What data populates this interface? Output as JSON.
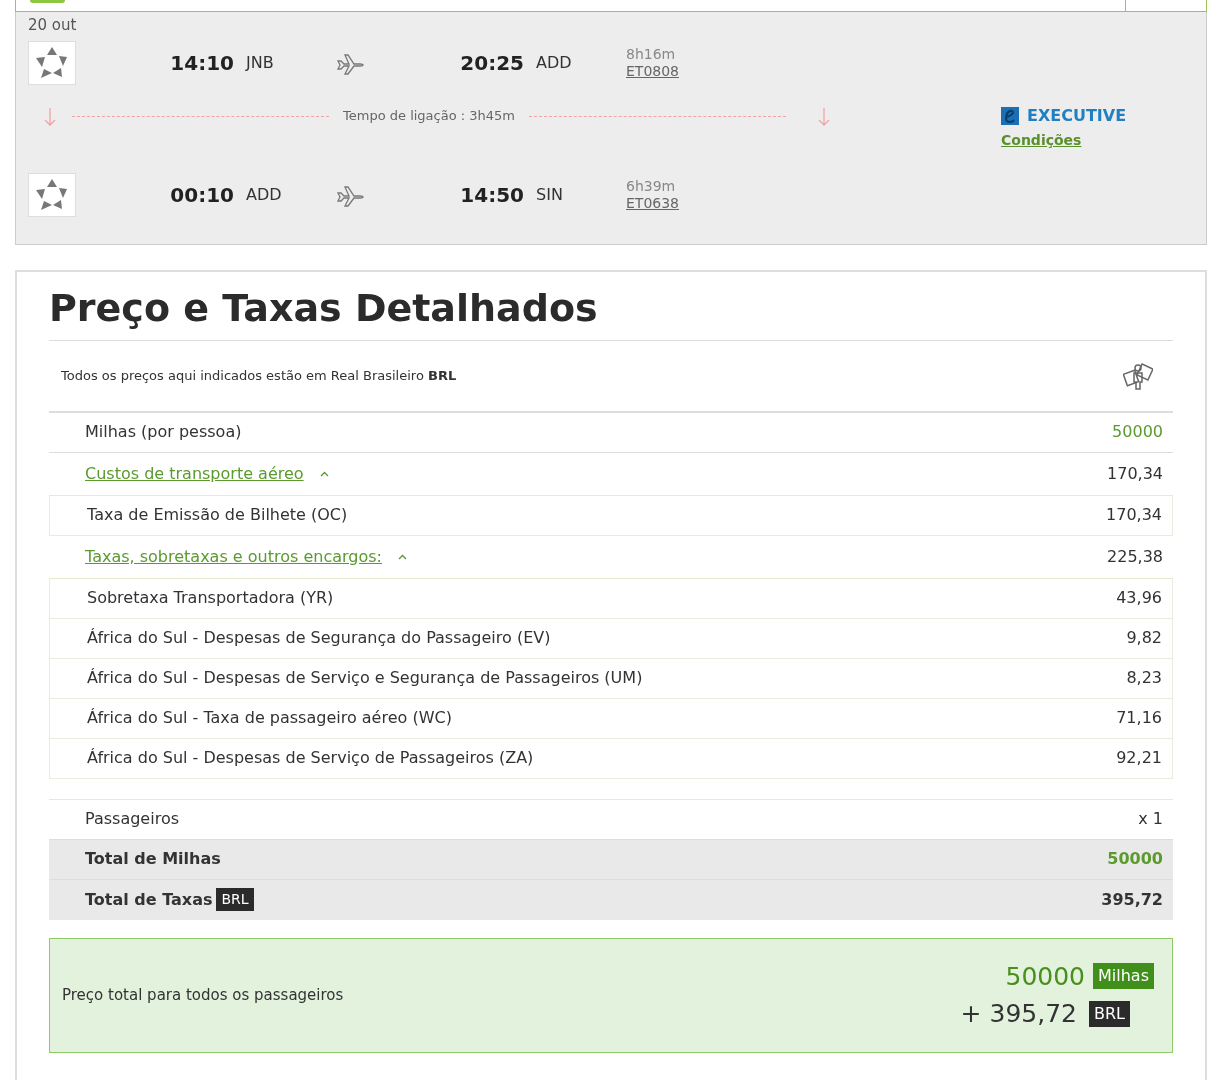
{
  "itinerary": {
    "date": "20 out",
    "segments": [
      {
        "departure_time": "14:10",
        "departure_airport": "JNB",
        "arrival_time": "20:25",
        "arrival_airport": "ADD",
        "duration": "8h16m",
        "flight_number": "ET0808"
      },
      {
        "departure_time": "00:10",
        "departure_airport": "ADD",
        "arrival_time": "14:50",
        "arrival_airport": "SIN",
        "duration": "6h39m",
        "flight_number": "ET0638"
      }
    ],
    "connection": "Tempo de ligação : 3h45m",
    "cabin": "EXECUTIVE",
    "conditions_link": "Condições"
  },
  "price_details": {
    "title": "Preço e Taxas Detalhados",
    "currency_note": "Todos os preços aqui indicados estão em Real Brasileiro **BRL**",
    "rows": [
      {
        "kind": "miles",
        "label": "Milhas (por pessoa)",
        "value": "50000"
      },
      {
        "kind": "group",
        "label": "Custos de transporte aéreo",
        "value": "170,34",
        "expanded": true
      },
      {
        "kind": "sub",
        "label": "Taxa de Emissão de Bilhete (OC)",
        "value": "170,34"
      },
      {
        "kind": "group",
        "label": "Taxas, sobretaxas e outros encargos:",
        "value": "225,38",
        "expanded": true
      },
      {
        "kind": "sub",
        "label": "Sobretaxa Transportadora (YR)",
        "value": "43,96"
      },
      {
        "kind": "sub",
        "label": "África do Sul - Despesas de Segurança do Passageiro (EV)",
        "value": "9,82"
      },
      {
        "kind": "sub",
        "label": "África do Sul - Despesas de Serviço e Segurança de Passageiros (UM)",
        "value": "8,23"
      },
      {
        "kind": "sub",
        "label": "África do Sul - Taxa de passageiro aéreo (WC)",
        "value": "71,16"
      },
      {
        "kind": "sub",
        "label": "África do Sul - Despesas de Serviço de Passageiros (ZA)",
        "value": "92,21"
      }
    ],
    "passengers": {
      "label": "Passageiros",
      "value": "x 1"
    },
    "total_miles": {
      "label": "Total de Milhas",
      "value": "50000"
    },
    "total_taxes": {
      "label": "Total de Taxas",
      "badge": "BRL",
      "value": "395,72"
    },
    "summary": {
      "label": "Preço total para todos os passageiros",
      "miles": "50000",
      "miles_unit": "Milhas",
      "taxes": "+ 395,72",
      "taxes_unit": "BRL"
    }
  }
}
